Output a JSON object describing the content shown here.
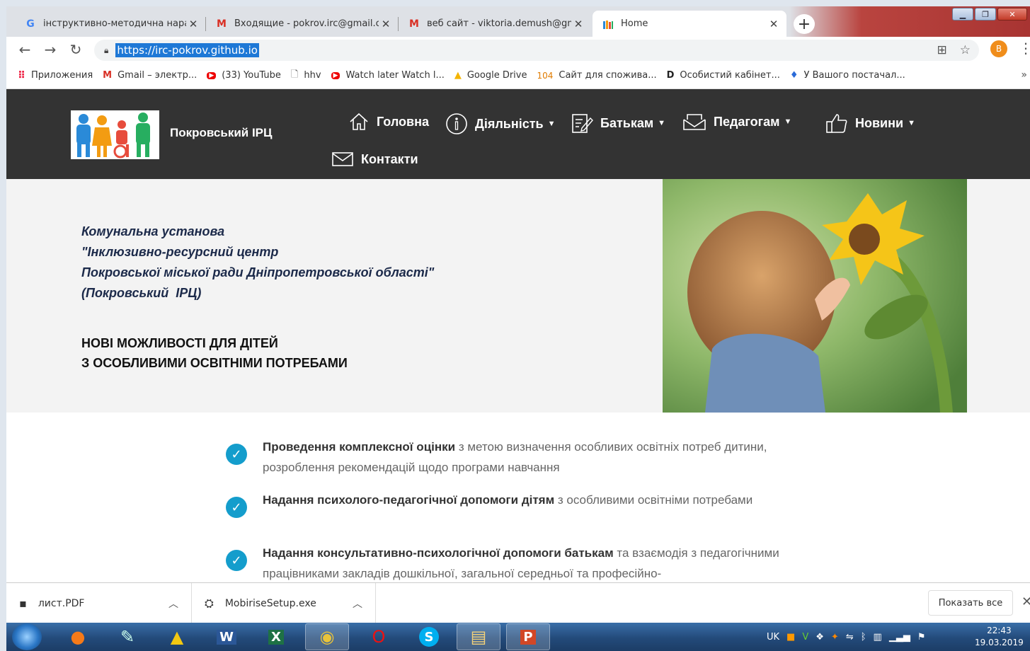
{
  "tabs": [
    {
      "title": "інструктивно-методична нарад",
      "icon": "google-icon"
    },
    {
      "title": "Входящие - pokrov.irc@gmail.cc",
      "icon": "gmail-icon"
    },
    {
      "title": "веб сайт - viktoria.demush@gm",
      "icon": "gmail-icon"
    },
    {
      "title": "Home",
      "icon": "site-favicon"
    }
  ],
  "address": {
    "url": "https://irc-pokrov.github.io"
  },
  "profile_initial": "В",
  "bookmarks": [
    {
      "label": "Приложения"
    },
    {
      "label": "Gmail – электр..."
    },
    {
      "label": "(33) YouTube"
    },
    {
      "label": "hhv"
    },
    {
      "label": "Watch later Watch l..."
    },
    {
      "label": "Google Drive"
    },
    {
      "label": "Сайт для спожива...",
      "prefix": "104"
    },
    {
      "label": "Особистий кабінет..."
    },
    {
      "label": "У Вашого постачал..."
    }
  ],
  "site": {
    "brand": "Покровський ІРЦ",
    "nav": {
      "home": "Головна",
      "activity": "Діяльність",
      "parents": "Батькам",
      "teachers": "Педагогам",
      "news": "Новини",
      "contacts": "Контакти"
    },
    "org_lines": [
      "Комунальна установа",
      "\"Інклюзивно-ресурсний центр",
      "Покровської міської ради Дніпропетровської області\"",
      "(Покровський  ІРЦ)"
    ],
    "slogan_lines": [
      "НОВІ МОЖЛИВОСТІ ДЛЯ ДІТЕЙ",
      "З ОСОБЛИВИМИ ОСВІТНІМИ ПОТРЕБАМИ"
    ],
    "features": [
      {
        "bold": "Проведення комплексної оцінки",
        "rest": " з метою визначення особливих освітніх потреб дитини, розроблення рекомендацій щодо програми навчання"
      },
      {
        "bold": "Надання психолого-педагогічної допомоги дітям",
        "rest": " з особливими освітніми потребами"
      },
      {
        "bold": "Надання консультативно-психологічної допомоги батькам",
        "rest": " та взаємодія з педагогічними працівниками закладів дошкільної, загальної середньої та професійно-"
      }
    ]
  },
  "downloads": {
    "items": [
      {
        "name": "лист.PDF"
      },
      {
        "name": "MobiriseSetup.exe"
      }
    ],
    "show_all": "Показать все"
  },
  "taskbar": {
    "lang": "UK",
    "time": "22:43",
    "date": "19.03.2019"
  },
  "colors": {
    "header_bg": "#333333",
    "hero_bg": "#f3f3f3",
    "check": "#149dcc",
    "org_text": "#1c2a4a"
  }
}
